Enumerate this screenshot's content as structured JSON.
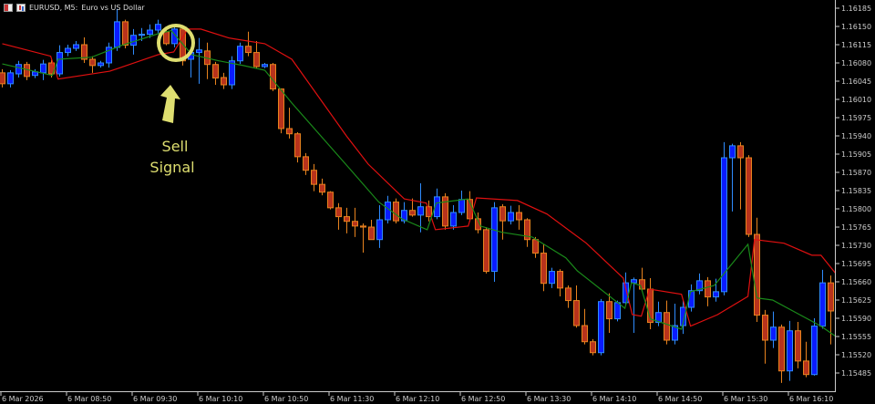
{
  "header": {
    "symbol": "EURUSD, M5:",
    "description": "Euro vs US Dollar"
  },
  "annotation": {
    "line1": "Sell",
    "line2": "Signal",
    "signal_candle_index": 22
  },
  "colors": {
    "bull_fill": "#0a1cff",
    "bull_edge": "#2f8cff",
    "bear_fill": "#b8331c",
    "bear_edge": "#e8831e",
    "upper_line": "#e01010",
    "ma_line": "#1a8a1a",
    "annotation": "#dede70",
    "axis": "#cccccc"
  },
  "chart_data": {
    "type": "candlestick",
    "title": "EURUSD, M5",
    "ylim": [
      1.15468,
      1.162
    ],
    "price_ticks": [
      "1.16185",
      "1.16150",
      "1.16115",
      "1.16080",
      "1.16045",
      "1.16010",
      "1.15975",
      "1.15940",
      "1.15905",
      "1.15870",
      "1.15835",
      "1.15800",
      "1.15765",
      "1.15730",
      "1.15695",
      "1.15660",
      "1.15625",
      "1.15590",
      "1.15555",
      "1.15520",
      "1.15485"
    ],
    "time_ticks": [
      "6 Mar 2026",
      "6 Mar 08:50",
      "6 Mar 09:30",
      "6 Mar 10:10",
      "6 Mar 10:50",
      "6 Mar 11:30",
      "6 Mar 12:10",
      "6 Mar 12:50",
      "6 Mar 13:30",
      "6 Mar 14:10",
      "6 Mar 14:50",
      "6 Mar 15:30",
      "6 Mar 16:10"
    ],
    "ohlc": [
      [
        1.16061,
        1.16068,
        1.16033,
        1.1604
      ],
      [
        1.1604,
        1.16066,
        1.16033,
        1.16061
      ],
      [
        1.16059,
        1.16084,
        1.16052,
        1.16077
      ],
      [
        1.16077,
        1.16082,
        1.16047,
        1.16054
      ],
      [
        1.16056,
        1.16068,
        1.16051,
        1.16063
      ],
      [
        1.16061,
        1.16086,
        1.16047,
        1.16078
      ],
      [
        1.1608,
        1.16086,
        1.16052,
        1.16059
      ],
      [
        1.16059,
        1.16114,
        1.16054,
        1.161
      ],
      [
        1.161,
        1.16115,
        1.16093,
        1.16108
      ],
      [
        1.16108,
        1.16122,
        1.16103,
        1.16115
      ],
      [
        1.16115,
        1.16129,
        1.1608,
        1.16087
      ],
      [
        1.16087,
        1.16093,
        1.16061,
        1.16075
      ],
      [
        1.16075,
        1.16084,
        1.16071,
        1.1608
      ],
      [
        1.1608,
        1.16119,
        1.16071,
        1.1611
      ],
      [
        1.1611,
        1.16184,
        1.16103,
        1.16159
      ],
      [
        1.16159,
        1.16163,
        1.16108,
        1.16114
      ],
      [
        1.16114,
        1.16145,
        1.16096,
        1.16133
      ],
      [
        1.16133,
        1.16147,
        1.16122,
        1.16135
      ],
      [
        1.16135,
        1.16154,
        1.16128,
        1.16143
      ],
      [
        1.16143,
        1.16163,
        1.16136,
        1.16154
      ],
      [
        1.1614,
        1.16149,
        1.16114,
        1.16117
      ],
      [
        1.16117,
        1.16149,
        1.1611,
        1.16145
      ],
      [
        1.16145,
        1.16149,
        1.16075,
        1.16084
      ],
      [
        1.16087,
        1.16105,
        1.16052,
        1.161
      ],
      [
        1.161,
        1.16128,
        1.1604,
        1.16105
      ],
      [
        1.16103,
        1.16119,
        1.16049,
        1.16077
      ],
      [
        1.16077,
        1.16082,
        1.16038,
        1.16051
      ],
      [
        1.16052,
        1.16061,
        1.1603,
        1.16038
      ],
      [
        1.16038,
        1.16093,
        1.1603,
        1.16084
      ],
      [
        1.16084,
        1.16119,
        1.16078,
        1.16112
      ],
      [
        1.16112,
        1.1614,
        1.16093,
        1.161
      ],
      [
        1.161,
        1.16122,
        1.1607,
        1.16073
      ],
      [
        1.16073,
        1.1608,
        1.1607,
        1.16077
      ],
      [
        1.16077,
        1.1608,
        1.16026,
        1.1603
      ],
      [
        1.1603,
        1.16031,
        1.15945,
        1.15954
      ],
      [
        1.15954,
        1.15994,
        1.15935,
        1.15944
      ],
      [
        1.15944,
        1.15947,
        1.15889,
        1.159
      ],
      [
        1.159,
        1.15907,
        1.15865,
        1.15874
      ],
      [
        1.15874,
        1.15886,
        1.15834,
        1.15847
      ],
      [
        1.15847,
        1.15858,
        1.15826,
        1.15832
      ],
      [
        1.15832,
        1.15834,
        1.15799,
        1.15802
      ],
      [
        1.15802,
        1.15811,
        1.1576,
        1.15785
      ],
      [
        1.15785,
        1.15802,
        1.15753,
        1.15776
      ],
      [
        1.15776,
        1.15802,
        1.15746,
        1.15767
      ],
      [
        1.15767,
        1.15772,
        1.15716,
        1.15765
      ],
      [
        1.15765,
        1.15779,
        1.15741,
        1.15741
      ],
      [
        1.15741,
        1.15807,
        1.15725,
        1.15779
      ],
      [
        1.15779,
        1.15825,
        1.15772,
        1.15813
      ],
      [
        1.15813,
        1.1582,
        1.15772,
        1.15777
      ],
      [
        1.15777,
        1.15813,
        1.15772,
        1.15797
      ],
      [
        1.15797,
        1.1582,
        1.15785,
        1.15788
      ],
      [
        1.15788,
        1.15849,
        1.15755,
        1.15804
      ],
      [
        1.15804,
        1.15816,
        1.15776,
        1.15785
      ],
      [
        1.15785,
        1.15839,
        1.1578,
        1.15823
      ],
      [
        1.15823,
        1.1583,
        1.1576,
        1.15767
      ],
      [
        1.15767,
        1.15807,
        1.1576,
        1.15793
      ],
      [
        1.15793,
        1.15835,
        1.15788,
        1.15818
      ],
      [
        1.15818,
        1.15834,
        1.15776,
        1.15781
      ],
      [
        1.15781,
        1.15793,
        1.15753,
        1.1576
      ],
      [
        1.1576,
        1.15765,
        1.15676,
        1.1568
      ],
      [
        1.1568,
        1.15813,
        1.1566,
        1.15802
      ],
      [
        1.15804,
        1.15809,
        1.15741,
        1.15777
      ],
      [
        1.15777,
        1.15806,
        1.1577,
        1.15793
      ],
      [
        1.15793,
        1.15807,
        1.1576,
        1.15779
      ],
      [
        1.15779,
        1.15782,
        1.15727,
        1.15741
      ],
      [
        1.15741,
        1.15746,
        1.15706,
        1.15715
      ],
      [
        1.15715,
        1.15732,
        1.15642,
        1.15657
      ],
      [
        1.15657,
        1.15687,
        1.15648,
        1.1568
      ],
      [
        1.1568,
        1.15684,
        1.15632,
        1.15648
      ],
      [
        1.15648,
        1.15653,
        1.1561,
        1.15624
      ],
      [
        1.15624,
        1.15653,
        1.15572,
        1.15576
      ],
      [
        1.15576,
        1.15608,
        1.1554,
        1.15545
      ],
      [
        1.15545,
        1.1555,
        1.15519,
        1.15524
      ],
      [
        1.15524,
        1.15627,
        1.15519,
        1.15622
      ],
      [
        1.15622,
        1.15638,
        1.15562,
        1.15589
      ],
      [
        1.15589,
        1.15624,
        1.15584,
        1.1562
      ],
      [
        1.1562,
        1.15678,
        1.15615,
        1.15658
      ],
      [
        1.15658,
        1.15668,
        1.15562,
        1.15664
      ],
      [
        1.15664,
        1.15687,
        1.15641,
        1.15646
      ],
      [
        1.15646,
        1.15667,
        1.15569,
        1.15582
      ],
      [
        1.15582,
        1.15622,
        1.15575,
        1.15601
      ],
      [
        1.15601,
        1.15624,
        1.1554,
        1.15548
      ],
      [
        1.15548,
        1.15618,
        1.1554,
        1.15576
      ],
      [
        1.15576,
        1.15624,
        1.1556,
        1.15611
      ],
      [
        1.15611,
        1.15655,
        1.15603,
        1.15643
      ],
      [
        1.15643,
        1.15676,
        1.15636,
        1.15662
      ],
      [
        1.15662,
        1.15669,
        1.15613,
        1.15631
      ],
      [
        1.15631,
        1.15666,
        1.15622,
        1.15641
      ],
      [
        1.15641,
        1.15928,
        1.15634,
        1.15898
      ],
      [
        1.15898,
        1.15925,
        1.15795,
        1.15921
      ],
      [
        1.15921,
        1.15928,
        1.15799,
        1.15898
      ],
      [
        1.15898,
        1.15903,
        1.15746,
        1.15751
      ],
      [
        1.15751,
        1.15783,
        1.15583,
        1.15596
      ],
      [
        1.15596,
        1.15606,
        1.15503,
        1.15548
      ],
      [
        1.15548,
        1.15603,
        1.15533,
        1.15573
      ],
      [
        1.15573,
        1.15578,
        1.15466,
        1.15489
      ],
      [
        1.15489,
        1.15585,
        1.1547,
        1.15566
      ],
      [
        1.15566,
        1.15583,
        1.15494,
        1.15508
      ],
      [
        1.15508,
        1.15545,
        1.15477,
        1.15482
      ],
      [
        1.15482,
        1.1559,
        1.1548,
        1.15575
      ],
      [
        1.15575,
        1.15683,
        1.1557,
        1.15658
      ],
      [
        1.15658,
        1.15672,
        1.1554,
        1.15604
      ],
      [
        1.15604,
        1.157,
        1.15557,
        1.15664
      ]
    ],
    "series": [
      {
        "name": "upper band",
        "points": [
          [
            0,
            1.16117
          ],
          [
            5.9,
            1.16093
          ],
          [
            6.8,
            1.16049
          ],
          [
            13.1,
            1.16064
          ],
          [
            19,
            1.16096
          ],
          [
            20.9,
            1.16101
          ],
          [
            22.6,
            1.16145
          ],
          [
            24.2,
            1.16145
          ],
          [
            27.6,
            1.16128
          ],
          [
            32,
            1.16117
          ],
          [
            35.3,
            1.16087
          ],
          [
            42,
            1.15939
          ],
          [
            44.6,
            1.15886
          ],
          [
            49,
            1.15819
          ],
          [
            51.7,
            1.15811
          ],
          [
            52.8,
            1.1576
          ],
          [
            56.8,
            1.15767
          ],
          [
            57.8,
            1.15821
          ],
          [
            62.8,
            1.15816
          ],
          [
            66.4,
            1.1579
          ],
          [
            71.2,
            1.15734
          ],
          [
            75.7,
            1.15667
          ],
          [
            76.8,
            1.15597
          ],
          [
            77.9,
            1.15594
          ],
          [
            78.9,
            1.15646
          ],
          [
            82.8,
            1.15636
          ],
          [
            83.9,
            1.15575
          ],
          [
            87.2,
            1.15597
          ],
          [
            90.9,
            1.15632
          ],
          [
            91.7,
            1.15741
          ],
          [
            95.3,
            1.15734
          ],
          [
            98.7,
            1.15711
          ],
          [
            99.8,
            1.15711
          ],
          [
            101.8,
            1.15672
          ]
        ]
      },
      {
        "name": "moving average",
        "points": [
          [
            0,
            1.16078
          ],
          [
            6.1,
            1.16056
          ],
          [
            6.8,
            1.16087
          ],
          [
            10.9,
            1.16091
          ],
          [
            14.6,
            1.16114
          ],
          [
            19,
            1.16136
          ],
          [
            20.6,
            1.16142
          ],
          [
            23.1,
            1.16096
          ],
          [
            26.4,
            1.16084
          ],
          [
            29.4,
            1.16075
          ],
          [
            32,
            1.16066
          ],
          [
            35.3,
            1.16003
          ],
          [
            42.8,
            1.15869
          ],
          [
            45.9,
            1.15813
          ],
          [
            48.7,
            1.15781
          ],
          [
            51.8,
            1.1576
          ],
          [
            52.9,
            1.15811
          ],
          [
            56.8,
            1.15819
          ],
          [
            58.3,
            1.15767
          ],
          [
            60.9,
            1.15755
          ],
          [
            64.6,
            1.15746
          ],
          [
            68.7,
            1.15706
          ],
          [
            70.1,
            1.15681
          ],
          [
            75.9,
            1.15609
          ],
          [
            76.7,
            1.15658
          ],
          [
            77.8,
            1.15653
          ],
          [
            79,
            1.15589
          ],
          [
            82.8,
            1.15569
          ],
          [
            83.9,
            1.15641
          ],
          [
            86.8,
            1.15653
          ],
          [
            90.9,
            1.15732
          ],
          [
            92,
            1.15629
          ],
          [
            93.9,
            1.15625
          ],
          [
            97.2,
            1.15597
          ],
          [
            99.8,
            1.15575
          ],
          [
            101.8,
            1.15553
          ]
        ]
      }
    ]
  }
}
